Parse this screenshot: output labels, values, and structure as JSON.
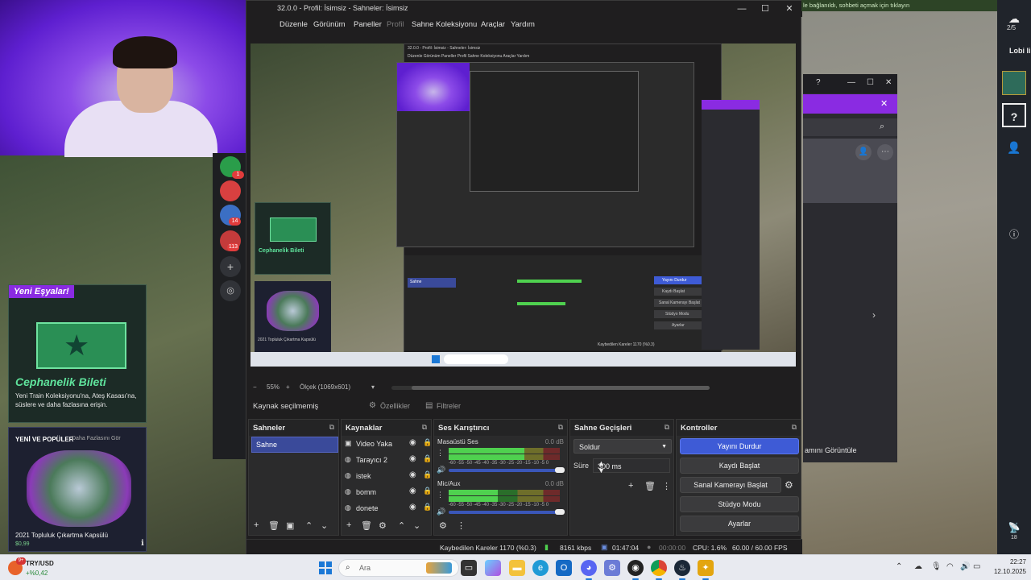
{
  "obs": {
    "title": "32.0.0 - Profil: İsimsiz - Sahneler: İsimsiz",
    "window_controls": {
      "minimize": "—",
      "maximize": "☐",
      "close": "✕"
    },
    "menu": [
      "Düzenle",
      "Görünüm",
      "Paneller",
      "Profil",
      "Sahne Koleksiyonu",
      "Araçlar",
      "Yardım"
    ],
    "zoom": {
      "percent": "55%",
      "scale": "Ölçek (1069x601)"
    },
    "context": {
      "label": "Kaynak seçilmemiş",
      "properties": "Özellikler",
      "filters": "Filtreler"
    },
    "scenes": {
      "title": "Sahneler",
      "items": [
        "Sahne"
      ]
    },
    "sources": {
      "title": "Kaynaklar",
      "items": [
        "Video Yaka",
        "Tarayıcı 2",
        "istek",
        "bomm",
        "donete"
      ]
    },
    "mixer": {
      "title": "Ses Karıştırıcı",
      "channels": [
        {
          "name": "Masaüstü Ses",
          "db": "0.0 dB",
          "level": 0.68,
          "volume": 1.0
        },
        {
          "name": "Mic/Aux",
          "db": "0.0 dB",
          "level": 0.44,
          "volume": 1.0
        }
      ],
      "scale": "-60 -55 -50 -45 -40 -35 -30 -25 -20 -15 -10 -5 0"
    },
    "transitions": {
      "title": "Sahne Geçişleri",
      "selected": "Soldur",
      "duration_label": "Süre",
      "duration": "300 ms"
    },
    "controls": {
      "title": "Kontroller",
      "stop_stream": "Yayını Durdur",
      "start_recording": "Kaydı Başlat",
      "virtual_camera": "Sanal Kamerayı Başlat",
      "studio_mode": "Stüdyo Modu",
      "settings": "Ayarlar"
    },
    "status": {
      "dropped": "Kaybedilen Kareler 1170 (%0.3)",
      "bitrate": "8161 kbps",
      "stream_time": "01:47:04",
      "rec_time": "00:00:00",
      "cpu": "CPU: 1.6%",
      "fps": "60.00 / 60.00 FPS"
    },
    "preview": {
      "inner_title": "32.0.0 - Profil: İsimsiz - Sahneler: İsimsiz",
      "inner_menu": "Düzenle  Görünüm  Paneller  Profil  Sahne Koleksiyonu  Araçlar  Yardım",
      "inner_scene": "Sahne",
      "inner_controls": [
        "Yayını Durdur",
        "Kaydı Başlat",
        "Sanal Kamerayı Başlat",
        "Stüdyo Modu",
        "Ayarlar"
      ],
      "inner_status": "Kaybedilen Kareler 1170 (%0.3)"
    }
  },
  "game": {
    "notification": "le bağlanıldı, sohbeti açmak için tıklayın",
    "lobby_count": "2/5",
    "lobby_label": "Lobi li",
    "card1": {
      "badge": "Yeni Eşyalar!",
      "title": "Cephanelik Bileti",
      "desc": "Yeni Train Koleksiyonu'na, Ateş Kasası'na, süslere ve daha fazlasına erişin."
    },
    "card2": {
      "badge": "YENİ VE POPÜLER",
      "badge2": "Daha Fazlasını Gör",
      "title": "2021 Topluluk Çıkartma Kapsülü",
      "price": "$0,99"
    },
    "right_text": "amını Görüntüle",
    "antenna_count": "18",
    "discord_badges": [
      "1",
      "14",
      "113"
    ]
  },
  "taskbar": {
    "currency": "TRY/USD",
    "change": "+%0,42",
    "weather_badge": "9+",
    "search": "Ara",
    "time": "22:27",
    "date": "12.10.2025",
    "apps": [
      "file-explorer",
      "edge",
      "outlook",
      "discord",
      "obs",
      "chrome",
      "steam",
      "cs2"
    ]
  }
}
